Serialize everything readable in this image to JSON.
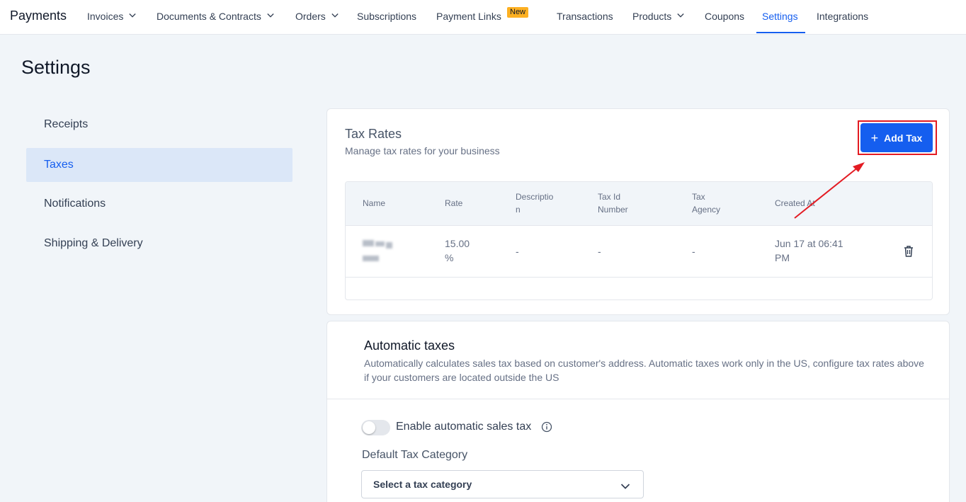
{
  "nav": {
    "brand": "Payments",
    "items": [
      {
        "label": "Invoices",
        "has_dropdown": true
      },
      {
        "label": "Documents & Contracts",
        "has_dropdown": true
      },
      {
        "label": "Orders",
        "has_dropdown": true
      },
      {
        "label": "Subscriptions",
        "has_dropdown": false
      },
      {
        "label": "Payment Links",
        "has_dropdown": false
      },
      {
        "label": "Transactions",
        "has_dropdown": false
      },
      {
        "label": "Products",
        "has_dropdown": true
      },
      {
        "label": "Coupons",
        "has_dropdown": false
      },
      {
        "label": "Settings",
        "has_dropdown": false,
        "active": true
      },
      {
        "label": "Integrations",
        "has_dropdown": false
      }
    ],
    "new_badge": "New"
  },
  "page": {
    "title": "Settings"
  },
  "sidebar": {
    "items": [
      {
        "label": "Receipts"
      },
      {
        "label": "Taxes",
        "active": true
      },
      {
        "label": "Notifications"
      },
      {
        "label": "Shipping & Delivery"
      }
    ]
  },
  "tax_rates": {
    "title": "Tax Rates",
    "subtitle": "Manage tax rates for your business",
    "add_button": "Add Tax",
    "add_icon": "+",
    "columns": [
      "Name",
      "Rate",
      "Descriptio\nn",
      "Tax Id\nNumber",
      "Tax\nAgency",
      "Created At"
    ],
    "rows": [
      {
        "name": "",
        "rate": "15.00\n%",
        "description": "-",
        "tax_id": "-",
        "agency": "-",
        "created_at": "Jun 17 at 06:41\nPM"
      }
    ]
  },
  "automatic_taxes": {
    "title": "Automatic taxes",
    "description": "Automatically calculates sales tax based on customer's address. Automatic taxes work only in the US, configure tax rates above if your customers are located outside the US",
    "toggle_label": "Enable automatic sales tax",
    "toggle_on": false,
    "category_label": "Default Tax Category",
    "category_placeholder": "Select a tax category"
  },
  "colors": {
    "accent": "#155eef",
    "highlight": "#e31b23",
    "badge": "#fdb022"
  }
}
